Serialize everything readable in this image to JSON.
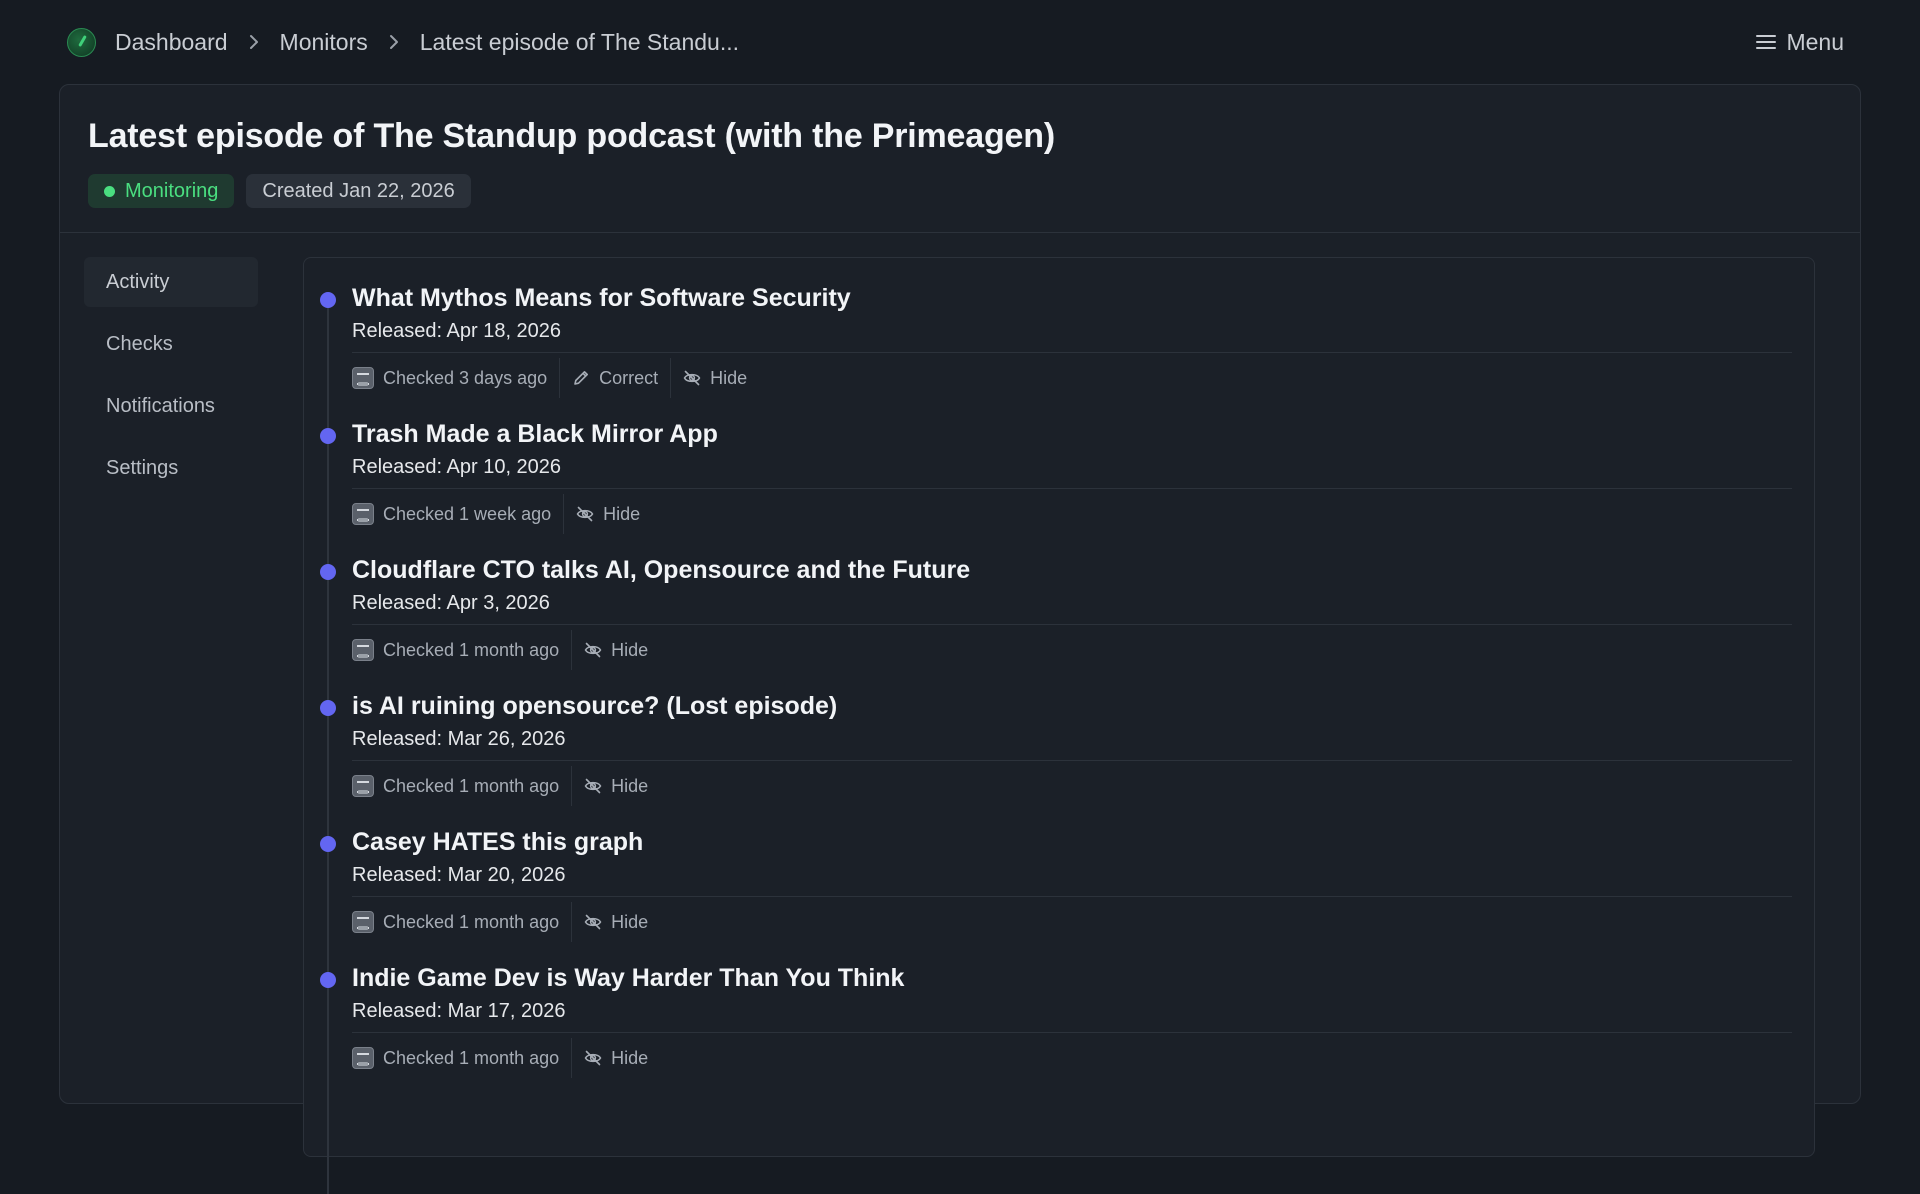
{
  "breadcrumb": {
    "items": [
      "Dashboard",
      "Monitors",
      "Latest episode of The Standu..."
    ],
    "separator_icon": "chevron-right-icon"
  },
  "menu": {
    "label": "Menu",
    "icon": "hamburger-icon"
  },
  "monitor": {
    "title": "Latest episode of The Standup podcast (with the Primeagen)",
    "status": "Monitoring",
    "status_color": "#4ade80",
    "created": "Created Jan 22, 2026"
  },
  "sidebar": {
    "items": [
      {
        "label": "Activity",
        "active": true
      },
      {
        "label": "Checks",
        "active": false
      },
      {
        "label": "Notifications",
        "active": false
      },
      {
        "label": "Settings",
        "active": false
      }
    ]
  },
  "activity": {
    "dot_color": "#6366f1",
    "entries": [
      {
        "title": "What Mythos Means for Software Security",
        "released": "Released: Apr 18, 2026",
        "checked": "Checked 3 days ago",
        "correct": "Correct",
        "hide": "Hide"
      },
      {
        "title": "Trash Made a Black Mirror App",
        "released": "Released: Apr 10, 2026",
        "checked": "Checked 1 week ago",
        "hide": "Hide"
      },
      {
        "title": "Cloudflare CTO talks AI, Opensource and the Future",
        "released": "Released: Apr 3, 2026",
        "checked": "Checked 1 month ago",
        "hide": "Hide"
      },
      {
        "title": "is AI ruining opensource? (Lost episode)",
        "released": "Released: Mar 26, 2026",
        "checked": "Checked 1 month ago",
        "hide": "Hide"
      },
      {
        "title": "Casey HATES this graph",
        "released": "Released: Mar 20, 2026",
        "checked": "Checked 1 month ago",
        "hide": "Hide"
      },
      {
        "title": "Indie Game Dev is Way Harder Than You Think",
        "released": "Released: Mar 17, 2026",
        "checked": "Checked 1 month ago",
        "hide": "Hide"
      }
    ]
  }
}
